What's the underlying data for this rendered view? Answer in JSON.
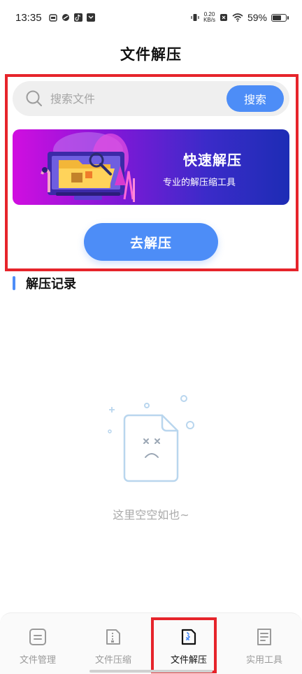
{
  "status_bar": {
    "time": "13:35",
    "net_speed_value": "0.20",
    "net_speed_unit": "KB/s",
    "battery_percent_text": "59%",
    "battery_level": 0.59
  },
  "header": {
    "title": "文件解压"
  },
  "search": {
    "placeholder": "搜索文件",
    "button_label": "搜索"
  },
  "banner": {
    "title": "快速解压",
    "subtitle": "专业的解压缩工具"
  },
  "main": {
    "decompress_button_label": "去解压",
    "records_title": "解压记录",
    "empty_text": "这里空空如也~"
  },
  "tabs": [
    {
      "label": "文件管理",
      "icon": "file-manage-icon",
      "active": false
    },
    {
      "label": "文件压缩",
      "icon": "file-compress-icon",
      "active": false
    },
    {
      "label": "文件解压",
      "icon": "file-decompress-icon",
      "active": true
    },
    {
      "label": "实用工具",
      "icon": "tools-icon",
      "active": false
    }
  ],
  "colors": {
    "accent": "#4d8df7",
    "highlight": "#e6242b",
    "banner_gradient_start": "#d10ee0",
    "banner_gradient_end": "#1d2cb5"
  }
}
